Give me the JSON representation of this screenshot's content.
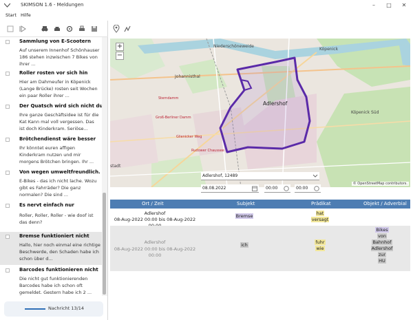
{
  "window": {
    "title": "SKIMSON 1.6 - Meldungen"
  },
  "menu": {
    "start": "Start",
    "help": "Hilfe"
  },
  "sidebar": {
    "items": [
      {
        "title": "Sammlung von E-Scootern",
        "text": "Auf unserem Innenhof Schönhauser 186 stehen inzwischen 7 Bikes von ihrer ..."
      },
      {
        "title": "Roller rosten vor sich hin",
        "text": "Hier am Dahmeufer in Köpenick (Lange Brücke) rosten seit Wochen ein paar Roller ihrer ..."
      },
      {
        "title": "Der Quatsch wird sich nicht durchse",
        "text": "Ihre ganze Geschäftsidee ist für die Kat Kann mal voll vergessen. Das ist doch Kinderkram. Seriöse..."
      },
      {
        "title": "Brötchendienst wäre besser",
        "text": "Ihr könntet euren affigen Kinderkram nutzen und mir morgens Brötchen bringen. Ihr ..."
      },
      {
        "title": "Von wegen umweltfreundlich.",
        "text": "E-Bikes - das ich nicht lache. Wozu gibt es Fahrräder? Die ganz normalen? Die sind ..."
      },
      {
        "title": "Es nervt einfach nur",
        "text": "Roller, Roller, Roller - wie doof ist das denn?"
      },
      {
        "title": "Bremse funktioniert nicht",
        "text": "Hallo, hier noch einmal eine richtige Beschwerde, den Schaden habe ich schon über d..."
      },
      {
        "title": "Barcodes funktionieren nicht",
        "text": "Die nicht gut funktionierenden Barcodes habe ich schon oft gemeldet. Gestern habe ich 2 ..."
      }
    ],
    "selected_index": 6,
    "pager_label": "Nachricht 13/14"
  },
  "map": {
    "labels": {
      "n1": "Niederschöneweide",
      "n2": "Köpenick",
      "n3": "Johannisthal",
      "n4": "Adlershof",
      "n5": "Köpenick Süd",
      "n6": "stadt"
    },
    "roads": {
      "r1": "Sterndamm",
      "r2": "Groß-Berliner Damm",
      "r3": "Glienicker Weg",
      "r4": "Rudower Chaussee"
    },
    "zoom_in": "+",
    "zoom_out": "−",
    "attribution": "© OpenStreetMap contributors."
  },
  "filters": {
    "location": "Adlershof,  12489",
    "date": "08.08.2022",
    "time_from": "00:00",
    "time_to": "00:00"
  },
  "table": {
    "headers": [
      "Ort / Zeit",
      "Subjekt",
      "Prädikat",
      "Objekt / Adverbial"
    ],
    "rows": [
      {
        "place": "Adlershof",
        "time": "08-Aug-2022 00:00 bis 08-Aug-2022 00:00",
        "subject": "Bremse",
        "predicate": [
          "hat",
          "versagt"
        ],
        "object": []
      },
      {
        "place": "Adlershof",
        "time": "08-Aug-2022 00:00 bis 08-Aug-2022 00:00",
        "subject": "ich",
        "predicate": [
          "fuhr",
          "wie"
        ],
        "object": [
          "Bikes",
          "von",
          "Bahnhof",
          "Adlershof",
          "zur",
          "HU"
        ]
      }
    ]
  },
  "colors": {
    "accent": "#4d7db3",
    "route": "#5a2aa8",
    "selected_row": "#e6e6e6"
  }
}
